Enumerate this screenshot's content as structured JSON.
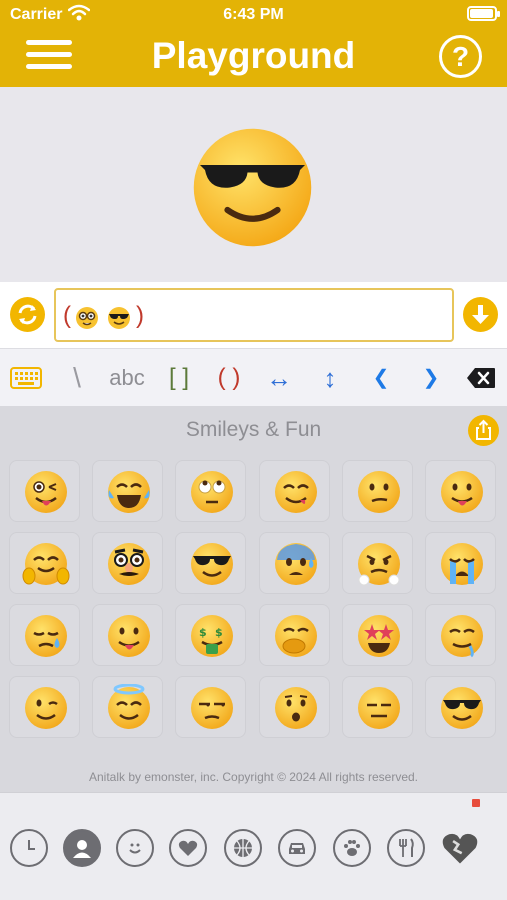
{
  "status_bar": {
    "carrier": "Carrier",
    "time": "6:43 PM",
    "battery_level": 0.95
  },
  "header": {
    "title": "Playground",
    "menu_icon": "hamburger-icon",
    "help_label": "?"
  },
  "preview": {
    "emoji": "smiling face with sunglasses"
  },
  "input": {
    "open_paren": "(",
    "close_paren": ")",
    "emojis": [
      "nerd face",
      "smiling face with sunglasses"
    ],
    "left_button_icon": "refresh-icon",
    "right_button_icon": "download-arrow-icon"
  },
  "toolbar": {
    "keyboard_icon": "keyboard-icon",
    "backslash": "\\",
    "abc": "abc",
    "brackets": "[ ]",
    "parens": "( )",
    "horizontal_arrows": "↔",
    "vertical_arrows": "↕",
    "left_chevron": "❮",
    "right_chevron": "❯",
    "delete_icon": "backspace-icon"
  },
  "panel": {
    "title": "Smileys & Fun",
    "share_icon": "share-icon",
    "emojis": [
      "winking face with tongue",
      "face with tears of joy",
      "face with rolling eyes",
      "face savoring food",
      "confused face",
      "face with tongue",
      "hugging face",
      "disguised face",
      "smiling face with sunglasses",
      "anxious face with sweat",
      "face with steam from nose",
      "loudly crying face",
      "sad but relieved face",
      "face with tongue",
      "money-mouth face",
      "face with hand over mouth",
      "star-struck",
      "drooling face",
      "winking face",
      "smiling face with halo",
      "unamused face",
      "hushed face",
      "expressionless face",
      "smiling face with sunglasses"
    ],
    "copyright": "Anitalk by emonster, inc. Copyright © 2024 All rights reserved."
  },
  "categories": [
    "recent-clock-icon",
    "person-icon",
    "smiley-icon",
    "heart-icon",
    "sports-ball-icon",
    "car-icon",
    "paw-icon",
    "fork-knife-icon",
    "animated-heart-icon"
  ],
  "colors": {
    "accent": "#e3b306",
    "button": "#f2b600",
    "paren_red": "#c0392b",
    "arrow_blue": "#2f6fd6"
  }
}
